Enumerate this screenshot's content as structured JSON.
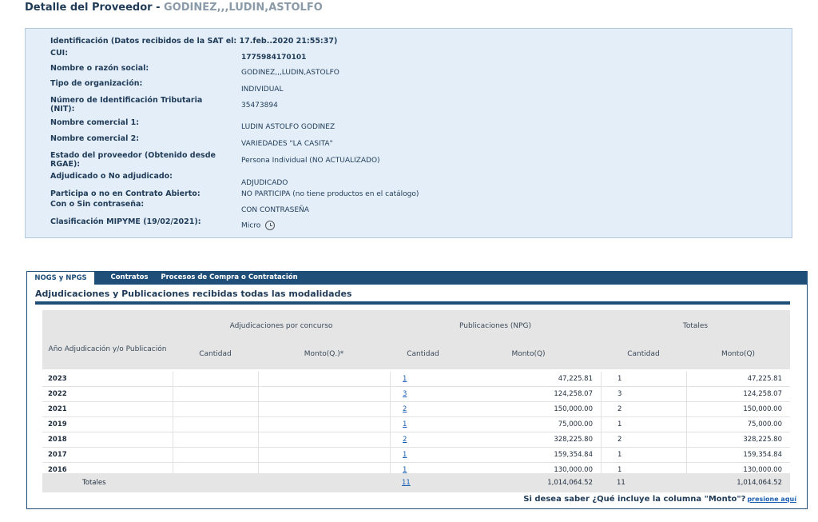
{
  "header": {
    "title_prefix": "Detalle del Proveedor - ",
    "provider_name": "GODINEZ,,,LUDIN,ASTOLFO"
  },
  "info": {
    "identification_header": "Identificación (Datos recibidos de la SAT el: 17.feb..2020 21:55:37)",
    "fields": [
      {
        "label": "CUI:",
        "value": "1775984170101"
      },
      {
        "label": "Nombre o razón social:",
        "value": "GODINEZ,,,LUDIN,ASTOLFO"
      },
      {
        "label": "Tipo de organización:",
        "value": "INDIVIDUAL"
      },
      {
        "label": "Número de Identificación Tributaria (NIT):",
        "value": "35473894"
      },
      {
        "label": "Nombre comercial 1:",
        "value": "LUDIN ASTOLFO GODINEZ"
      },
      {
        "label": "Nombre comercial 2:",
        "value": "VARIEDADES \"LA CASITA\""
      },
      {
        "label": "Estado del proveedor (Obtenido desde RGAE):",
        "value": "Persona Individual (NO ACTUALIZADO)"
      },
      {
        "label": "Adjudicado o No adjudicado:",
        "value": "ADJUDICADO"
      },
      {
        "label": "Participa o no en Contrato Abierto:",
        "value": "NO PARTICIPA (no tiene productos en el catálogo)"
      },
      {
        "label": "Con o Sin contraseña:",
        "value": "CON CONTRASEÑA"
      },
      {
        "label": "Clasificación MIPYME (19/02/2021):",
        "value": "Micro"
      }
    ]
  },
  "tabs": [
    {
      "label": "NOGS y NPGS"
    },
    {
      "label": "Contratos"
    },
    {
      "label": "Procesos de Compra o Contratación"
    }
  ],
  "section": {
    "title": "Adjudicaciones y Publicaciones recibidas todas las modalidades"
  },
  "table": {
    "group_headers": [
      "Adjudicaciones por concurso",
      "Publicaciones (NPG)",
      "Totales"
    ],
    "columns": [
      "Año Adjudicación y/o Publicación",
      "Cantidad",
      "Monto(Q.)*",
      "Cantidad",
      "Monto(Q)",
      "Cantidad",
      "Monto(Q)"
    ],
    "rows": [
      {
        "year": "2023",
        "pub_count": "1",
        "pub_amount": "47,225.81",
        "tot_count": "1",
        "tot_amount": "47,225.81"
      },
      {
        "year": "2022",
        "pub_count": "3",
        "pub_amount": "124,258.07",
        "tot_count": "3",
        "tot_amount": "124,258.07"
      },
      {
        "year": "2021",
        "pub_count": "2",
        "pub_amount": "150,000.00",
        "tot_count": "2",
        "tot_amount": "150,000.00"
      },
      {
        "year": "2019",
        "pub_count": "1",
        "pub_amount": "75,000.00",
        "tot_count": "1",
        "tot_amount": "75,000.00"
      },
      {
        "year": "2018",
        "pub_count": "2",
        "pub_amount": "328,225.80",
        "tot_count": "2",
        "tot_amount": "328,225.80"
      },
      {
        "year": "2017",
        "pub_count": "1",
        "pub_amount": "159,354.84",
        "tot_count": "1",
        "tot_amount": "159,354.84"
      },
      {
        "year": "2016",
        "pub_count": "1",
        "pub_amount": "130,000.00",
        "tot_count": "1",
        "tot_amount": "130,000.00"
      }
    ],
    "totals": {
      "label": "Totales",
      "pub_count": "11",
      "pub_amount": "1,014,064.52",
      "tot_count": "11",
      "tot_amount": "1,014,064.52"
    }
  },
  "footnote": {
    "text": "Si desea saber ¿Qué incluye la columna \"Monto\"?",
    "link": "presione aquí"
  },
  "colors": {
    "primary": "#1f4e79",
    "info_bg": "#e3eef9",
    "link": "#1a5fb4"
  }
}
